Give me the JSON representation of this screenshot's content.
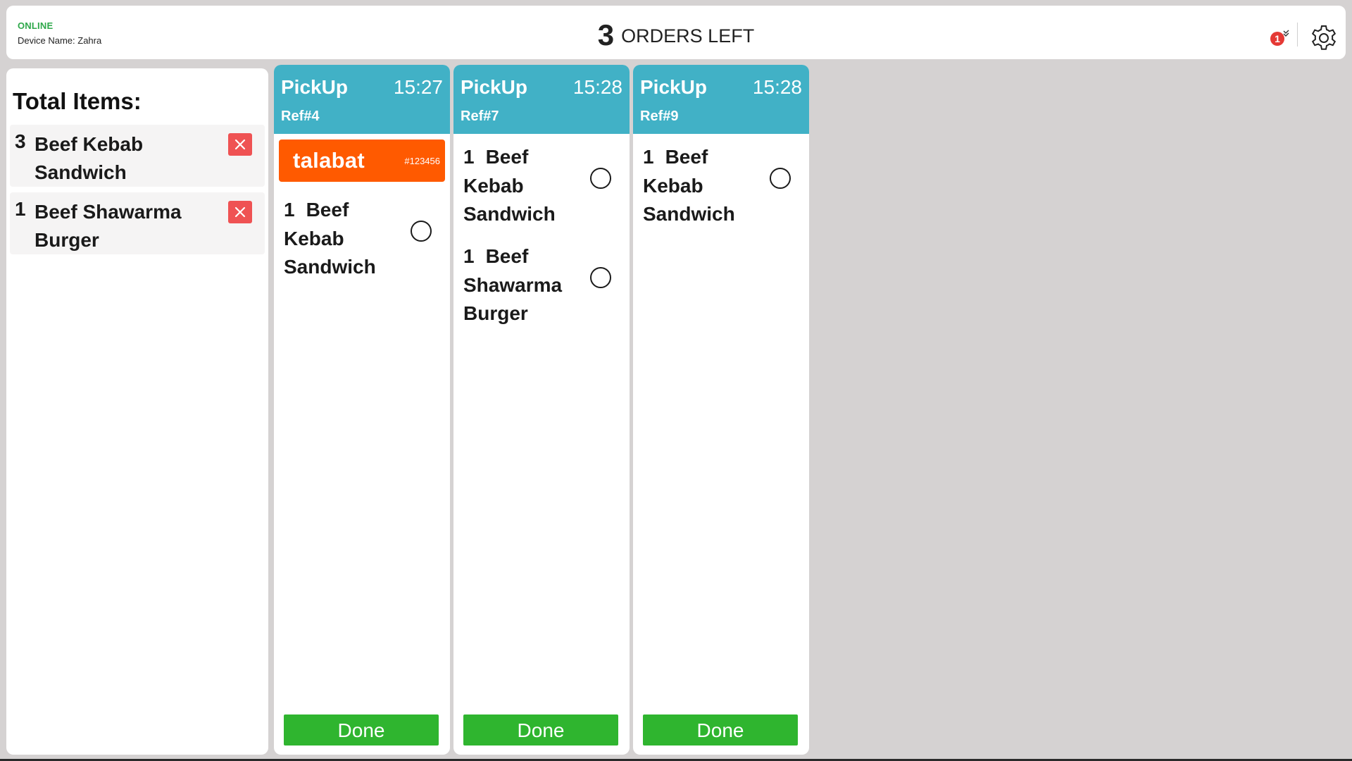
{
  "header": {
    "status": "ONLINE",
    "device_name": "Device Name: Zahra",
    "orders_left_count": "3",
    "orders_left_label": "ORDERS LEFT",
    "notification_count": "1",
    "notification_icon": "double-check-icon",
    "settings_icon": "gear-icon"
  },
  "colors": {
    "online": "#2ea84a",
    "card_header": "#41b1c6",
    "talabat": "#ff5a00",
    "done": "#2fb52f",
    "remove": "#ef5253",
    "badge": "#e53935"
  },
  "sidebar": {
    "title": "Total Items:",
    "items": [
      {
        "qty": "3",
        "name": "Beef Kebab Sandwich"
      },
      {
        "qty": "1",
        "name": "Beef Shawarma Burger"
      }
    ]
  },
  "orders": [
    {
      "type": "PickUp",
      "time": "15:27",
      "ref": "Ref#4",
      "platform": "talabat",
      "platform_order_no": "#123456",
      "items": [
        {
          "qty": "1",
          "name": "Beef Kebab Sandwich"
        }
      ],
      "done_label": "Done"
    },
    {
      "type": "PickUp",
      "time": "15:28",
      "ref": "Ref#7",
      "items": [
        {
          "qty": "1",
          "name": "Beef Kebab Sandwich"
        },
        {
          "qty": "1",
          "name": "Beef Shawarma Burger"
        }
      ],
      "done_label": "Done"
    },
    {
      "type": "PickUp",
      "time": "15:28",
      "ref": "Ref#9",
      "items": [
        {
          "qty": "1",
          "name": "Beef Kebab Sandwich"
        }
      ],
      "done_label": "Done"
    }
  ]
}
